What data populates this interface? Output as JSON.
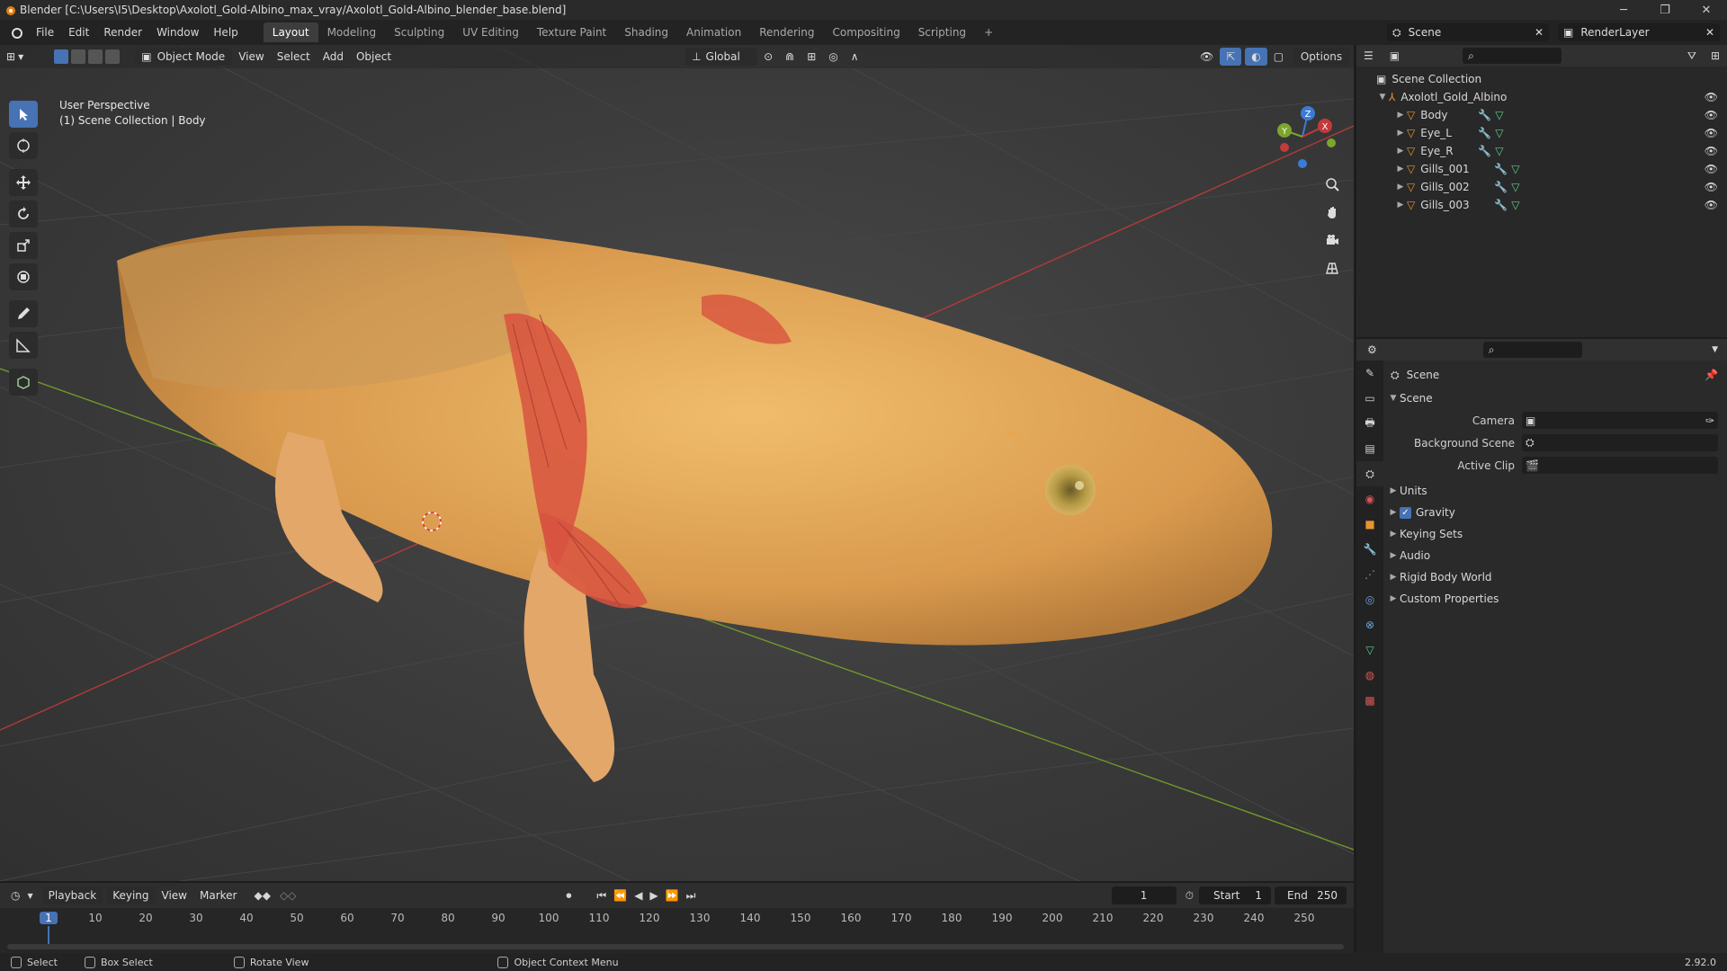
{
  "window": {
    "title": "Blender [C:\\Users\\I5\\Desktop\\Axolotl_Gold-Albino_max_vray/Axolotl_Gold-Albino_blender_base.blend]"
  },
  "menus": [
    "File",
    "Edit",
    "Render",
    "Window",
    "Help"
  ],
  "workspaces": [
    "Layout",
    "Modeling",
    "Sculpting",
    "UV Editing",
    "Texture Paint",
    "Shading",
    "Animation",
    "Rendering",
    "Compositing",
    "Scripting"
  ],
  "active_workspace": "Layout",
  "topbar": {
    "scene": "Scene",
    "view_layer": "RenderLayer",
    "options_label": "Options"
  },
  "viewport": {
    "mode": "Object Mode",
    "menus": [
      "View",
      "Select",
      "Add",
      "Object"
    ],
    "transform_orientation": "Global",
    "overlay_title": "User Perspective",
    "overlay_subtitle": "(1) Scene Collection | Body",
    "gizmo_labels": [
      "Z",
      "Y",
      "X"
    ]
  },
  "outliner": {
    "root": "Scene Collection",
    "collection": "Axolotl_Gold_Albino",
    "objects": [
      "Body",
      "Eye_L",
      "Eye_R",
      "Gills_001",
      "Gills_002",
      "Gills_003"
    ]
  },
  "properties": {
    "context": "Scene",
    "panel": "Scene",
    "fields": [
      {
        "label": "Camera",
        "value": ""
      },
      {
        "label": "Background Scene",
        "value": ""
      },
      {
        "label": "Active Clip",
        "value": ""
      }
    ],
    "subpanels": [
      "Units",
      "Gravity",
      "Keying Sets",
      "Audio",
      "Rigid Body World",
      "Custom Properties"
    ],
    "gravity_checked": true
  },
  "timeline": {
    "menus": [
      "Playback",
      "Keying",
      "View",
      "Marker"
    ],
    "current_frame": "1",
    "start_label": "Start",
    "start": "1",
    "end_label": "End",
    "end": "250",
    "ruler": [
      "1",
      "10",
      "20",
      "30",
      "40",
      "50",
      "60",
      "70",
      "80",
      "90",
      "100",
      "110",
      "120",
      "130",
      "140",
      "150",
      "160",
      "170",
      "180",
      "190",
      "200",
      "210",
      "220",
      "230",
      "240",
      "250"
    ]
  },
  "statusbar": {
    "select": "Select",
    "box_select": "Box Select",
    "rotate_view": "Rotate View",
    "context_menu": "Object Context Menu",
    "version": "2.92.0"
  },
  "colors": {
    "accent": "#4772b3",
    "x_axis": "#c23b3b",
    "y_axis": "#7ca52b",
    "z_axis": "#3b7bd6",
    "body": "#e4a95a",
    "gills": "#d8523f"
  }
}
